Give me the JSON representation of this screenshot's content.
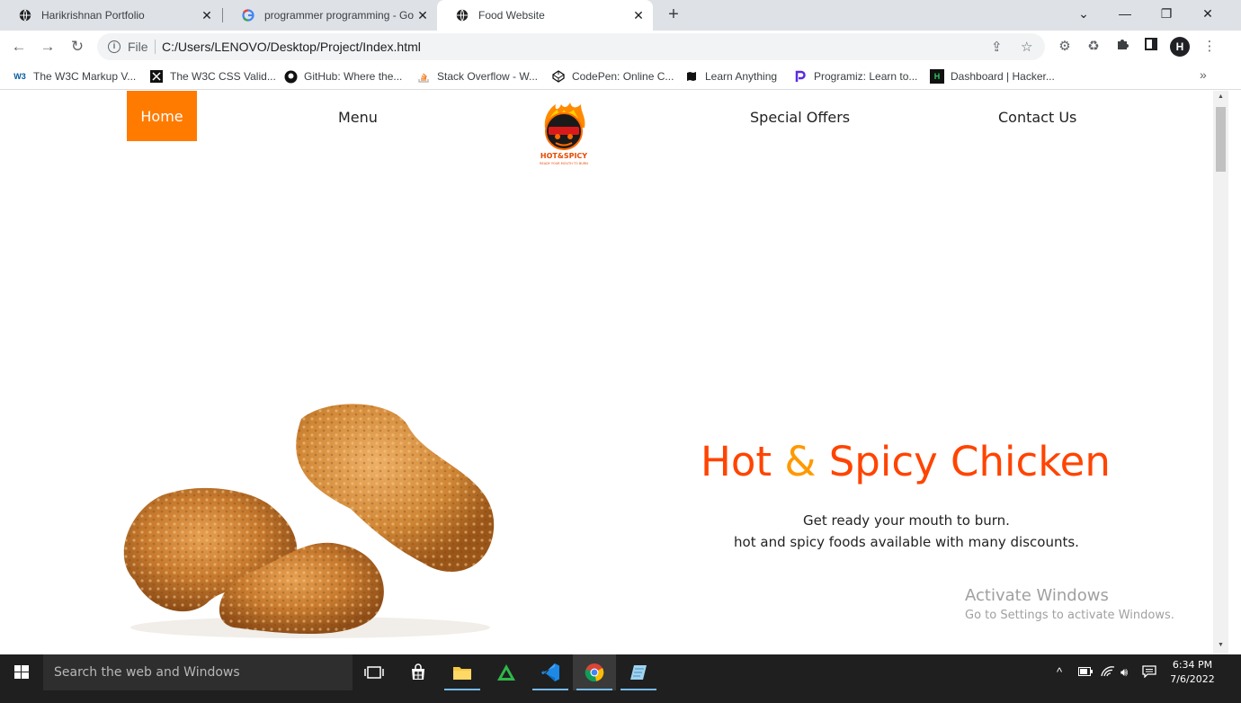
{
  "browser": {
    "tabs": [
      {
        "title": "Harikrishnan Portfolio",
        "icon": "globe-icon",
        "active": false
      },
      {
        "title": "programmer programming - Goo",
        "icon": "google-icon",
        "active": false
      },
      {
        "title": "Food Website",
        "icon": "globe-icon",
        "active": true
      }
    ],
    "new_tab": "+",
    "window_controls": {
      "dropdown": "⌄",
      "minimize": "—",
      "restore": "❐",
      "close": "✕"
    },
    "address": {
      "scheme_label": "File",
      "url": "C:/Users/LENOVO/Desktop/Project/Index.html"
    },
    "bookmarks": [
      {
        "label": "The W3C Markup V...",
        "icon": "w3c-icon"
      },
      {
        "label": "The W3C CSS Valid...",
        "icon": "css-validator-icon"
      },
      {
        "label": "GitHub: Where the...",
        "icon": "github-icon"
      },
      {
        "label": "Stack Overflow - W...",
        "icon": "stackoverflow-icon"
      },
      {
        "label": "CodePen: Online C...",
        "icon": "codepen-icon"
      },
      {
        "label": "Learn Anything",
        "icon": "map-icon"
      },
      {
        "label": "Programiz: Learn to...",
        "icon": "programiz-icon"
      },
      {
        "label": "Dashboard | Hacker...",
        "icon": "hackerrank-icon"
      }
    ],
    "bookmarks_more": "»",
    "profile_initial": "H"
  },
  "site": {
    "nav": {
      "home": "Home",
      "menu": "Menu",
      "special_offers": "Special Offers",
      "contact_us": "Contact Us"
    },
    "logo": {
      "name": "HOT&SPICY",
      "tagline": "READY YOUR MOUTH TO BURN"
    },
    "hero": {
      "title_part1": "Hot ",
      "title_amp": "&",
      "title_part2": " Spicy Chicken",
      "line1": "Get ready your mouth to burn.",
      "line2": "hot and spicy foods available with many discounts."
    },
    "accent_color": "#ff7b00"
  },
  "os": {
    "watermark_title": "Activate Windows",
    "watermark_sub": "Go to Settings to activate Windows.",
    "search_placeholder": "Search the web and Windows",
    "time": "6:34 PM",
    "date": "7/6/2022"
  }
}
